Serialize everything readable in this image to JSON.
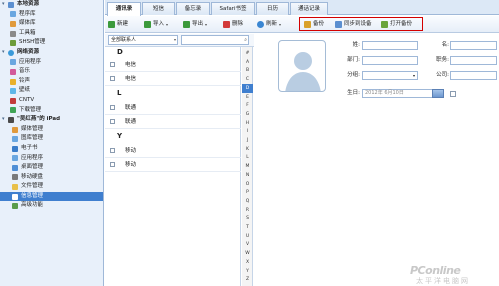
{
  "sidebar": {
    "groups": [
      {
        "label": "本地资源",
        "items": [
          "程序库",
          "媒体库",
          "工具箱",
          "SHSH管理"
        ]
      },
      {
        "label": "网络资源",
        "items": [
          "应用程序",
          "音乐",
          "铃声",
          "壁纸",
          "CNTV",
          "下载管理"
        ]
      },
      {
        "label": "\"吴红燕\"的 iPad",
        "items": [
          "媒体管理",
          "图库管理",
          "电子书",
          "应用程序",
          "桌面管理",
          "移动硬盘",
          "文件管理",
          "信息管理",
          "高级功能"
        ]
      }
    ],
    "selected": "信息管理"
  },
  "tabs": [
    "通讯录",
    "短信",
    "备忘录",
    "Safari书签",
    "日历",
    "通话记录"
  ],
  "active_tab": "通讯录",
  "toolbar": {
    "new": "新建",
    "import": "导入",
    "export": "导出",
    "delete": "删除",
    "refresh": "刷新",
    "backup": "备份",
    "sync_to_device": "同步到设备",
    "open_backup": "打开备份"
  },
  "filter": {
    "group_select": "全部联系人",
    "search_value": ""
  },
  "contacts": {
    "groups": [
      {
        "letter": "D",
        "rows": [
          "电信",
          "电信"
        ]
      },
      {
        "letter": "L",
        "rows": [
          "联通",
          "联通"
        ]
      },
      {
        "letter": "Y",
        "rows": [
          "移动",
          "移动"
        ]
      }
    ]
  },
  "alphabet": [
    "#",
    "A",
    "B",
    "C",
    "D",
    "E",
    "F",
    "G",
    "H",
    "I",
    "J",
    "K",
    "L",
    "M",
    "N",
    "O",
    "P",
    "Q",
    "R",
    "S",
    "T",
    "U",
    "V",
    "W",
    "X",
    "Y",
    "Z"
  ],
  "alphabet_selected": "D",
  "detail": {
    "surname_label": "姓:",
    "given_label": "名:",
    "dept_label": "部门:",
    "title_label": "职务:",
    "group_label": "分组:",
    "company_label": "公司:",
    "birthday_label": "生日:",
    "birthday_value": "2012年 6月10日"
  },
  "watermark": {
    "brand": "PConline",
    "sub": "太平洋电脑网"
  },
  "colors": {
    "accent": "#3f7fcf",
    "highlight_box": "#d40000",
    "sidebar_bg": "#e8f0fa"
  }
}
